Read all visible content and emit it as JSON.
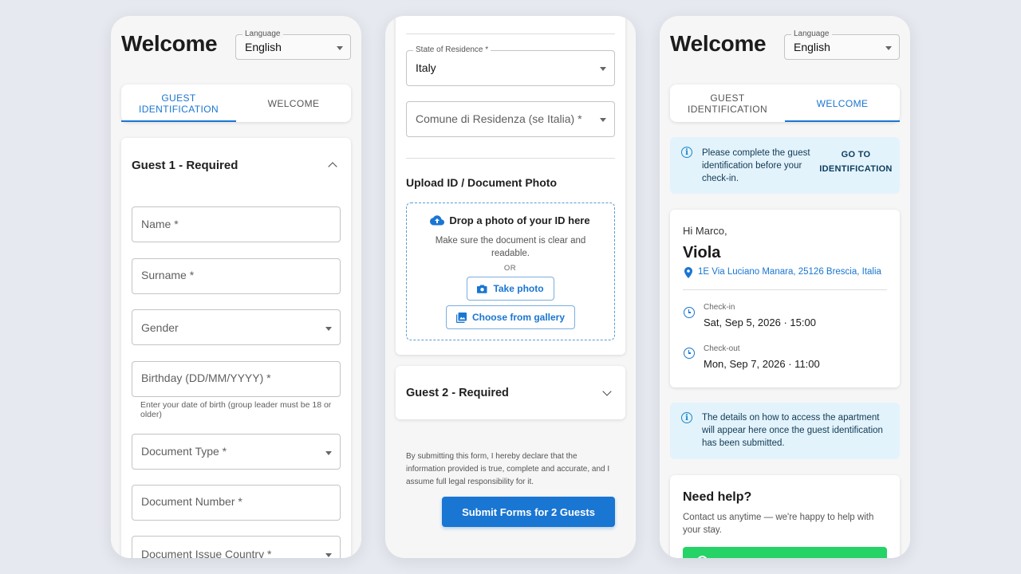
{
  "colors": {
    "accent": "#1976d2",
    "info_bg": "#e3f3fb",
    "whatsapp_green": "#25d366"
  },
  "phone1": {
    "title": "Welcome",
    "language": {
      "label": "Language",
      "value": "English"
    },
    "tabs": [
      {
        "label": "Guest Identification",
        "active": true
      },
      {
        "label": "Welcome",
        "active": false
      }
    ],
    "guest_section_title": "Guest 1 - Required",
    "fields": {
      "name": "Name *",
      "surname": "Surname *",
      "gender": "Gender",
      "birthday": "Birthday (DD/MM/YYYY) *",
      "birthday_helper": "Enter your date of birth (group leader must be 18 or older)",
      "document_type": "Document Type *",
      "document_number": "Document Number *",
      "document_issue_country": "Document Issue Country *"
    }
  },
  "phone2": {
    "state_of_residence": {
      "label": "State of Residence *",
      "value": "Italy"
    },
    "comune": "Comune di Residenza (se Italia) *",
    "upload": {
      "title": "Upload ID / Document Photo",
      "drop_title": "Drop a photo of your ID here",
      "drop_hint": "Make sure the document is clear and readable.",
      "or": "OR",
      "take_photo": "Take photo",
      "choose_gallery": "Choose from gallery"
    },
    "guest2_title": "Guest 2 - Required",
    "disclaimer": "By submitting this form, I hereby declare that the information provided is true, complete and accurate, and I assume full legal responsibility for it.",
    "submit_label": "Submit Forms for 2 Guests"
  },
  "phone3": {
    "title": "Welcome",
    "language": {
      "label": "Language",
      "value": "English"
    },
    "tabs": [
      {
        "label": "Guest Identification",
        "active": false
      },
      {
        "label": "Welcome",
        "active": true
      }
    ],
    "alert_identification": {
      "text": "Please complete the guest identification before your check-in.",
      "action": "Go to Identification"
    },
    "booking": {
      "greeting": "Hi Marco,",
      "property": "Viola",
      "address": "1E Via Luciano Manara, 25126 Brescia, Italia",
      "checkin_label": "Check-in",
      "checkin_value": "Sat, Sep 5, 2026 · 15:00",
      "checkout_label": "Check-out",
      "checkout_value": "Mon, Sep 7, 2026 · 11:00"
    },
    "alert_access": {
      "text": "The details on how to access the apartment will appear here once the guest identification has been submitted."
    },
    "help": {
      "title": "Need help?",
      "text": "Contact us anytime — we're happy to help with your stay."
    }
  }
}
